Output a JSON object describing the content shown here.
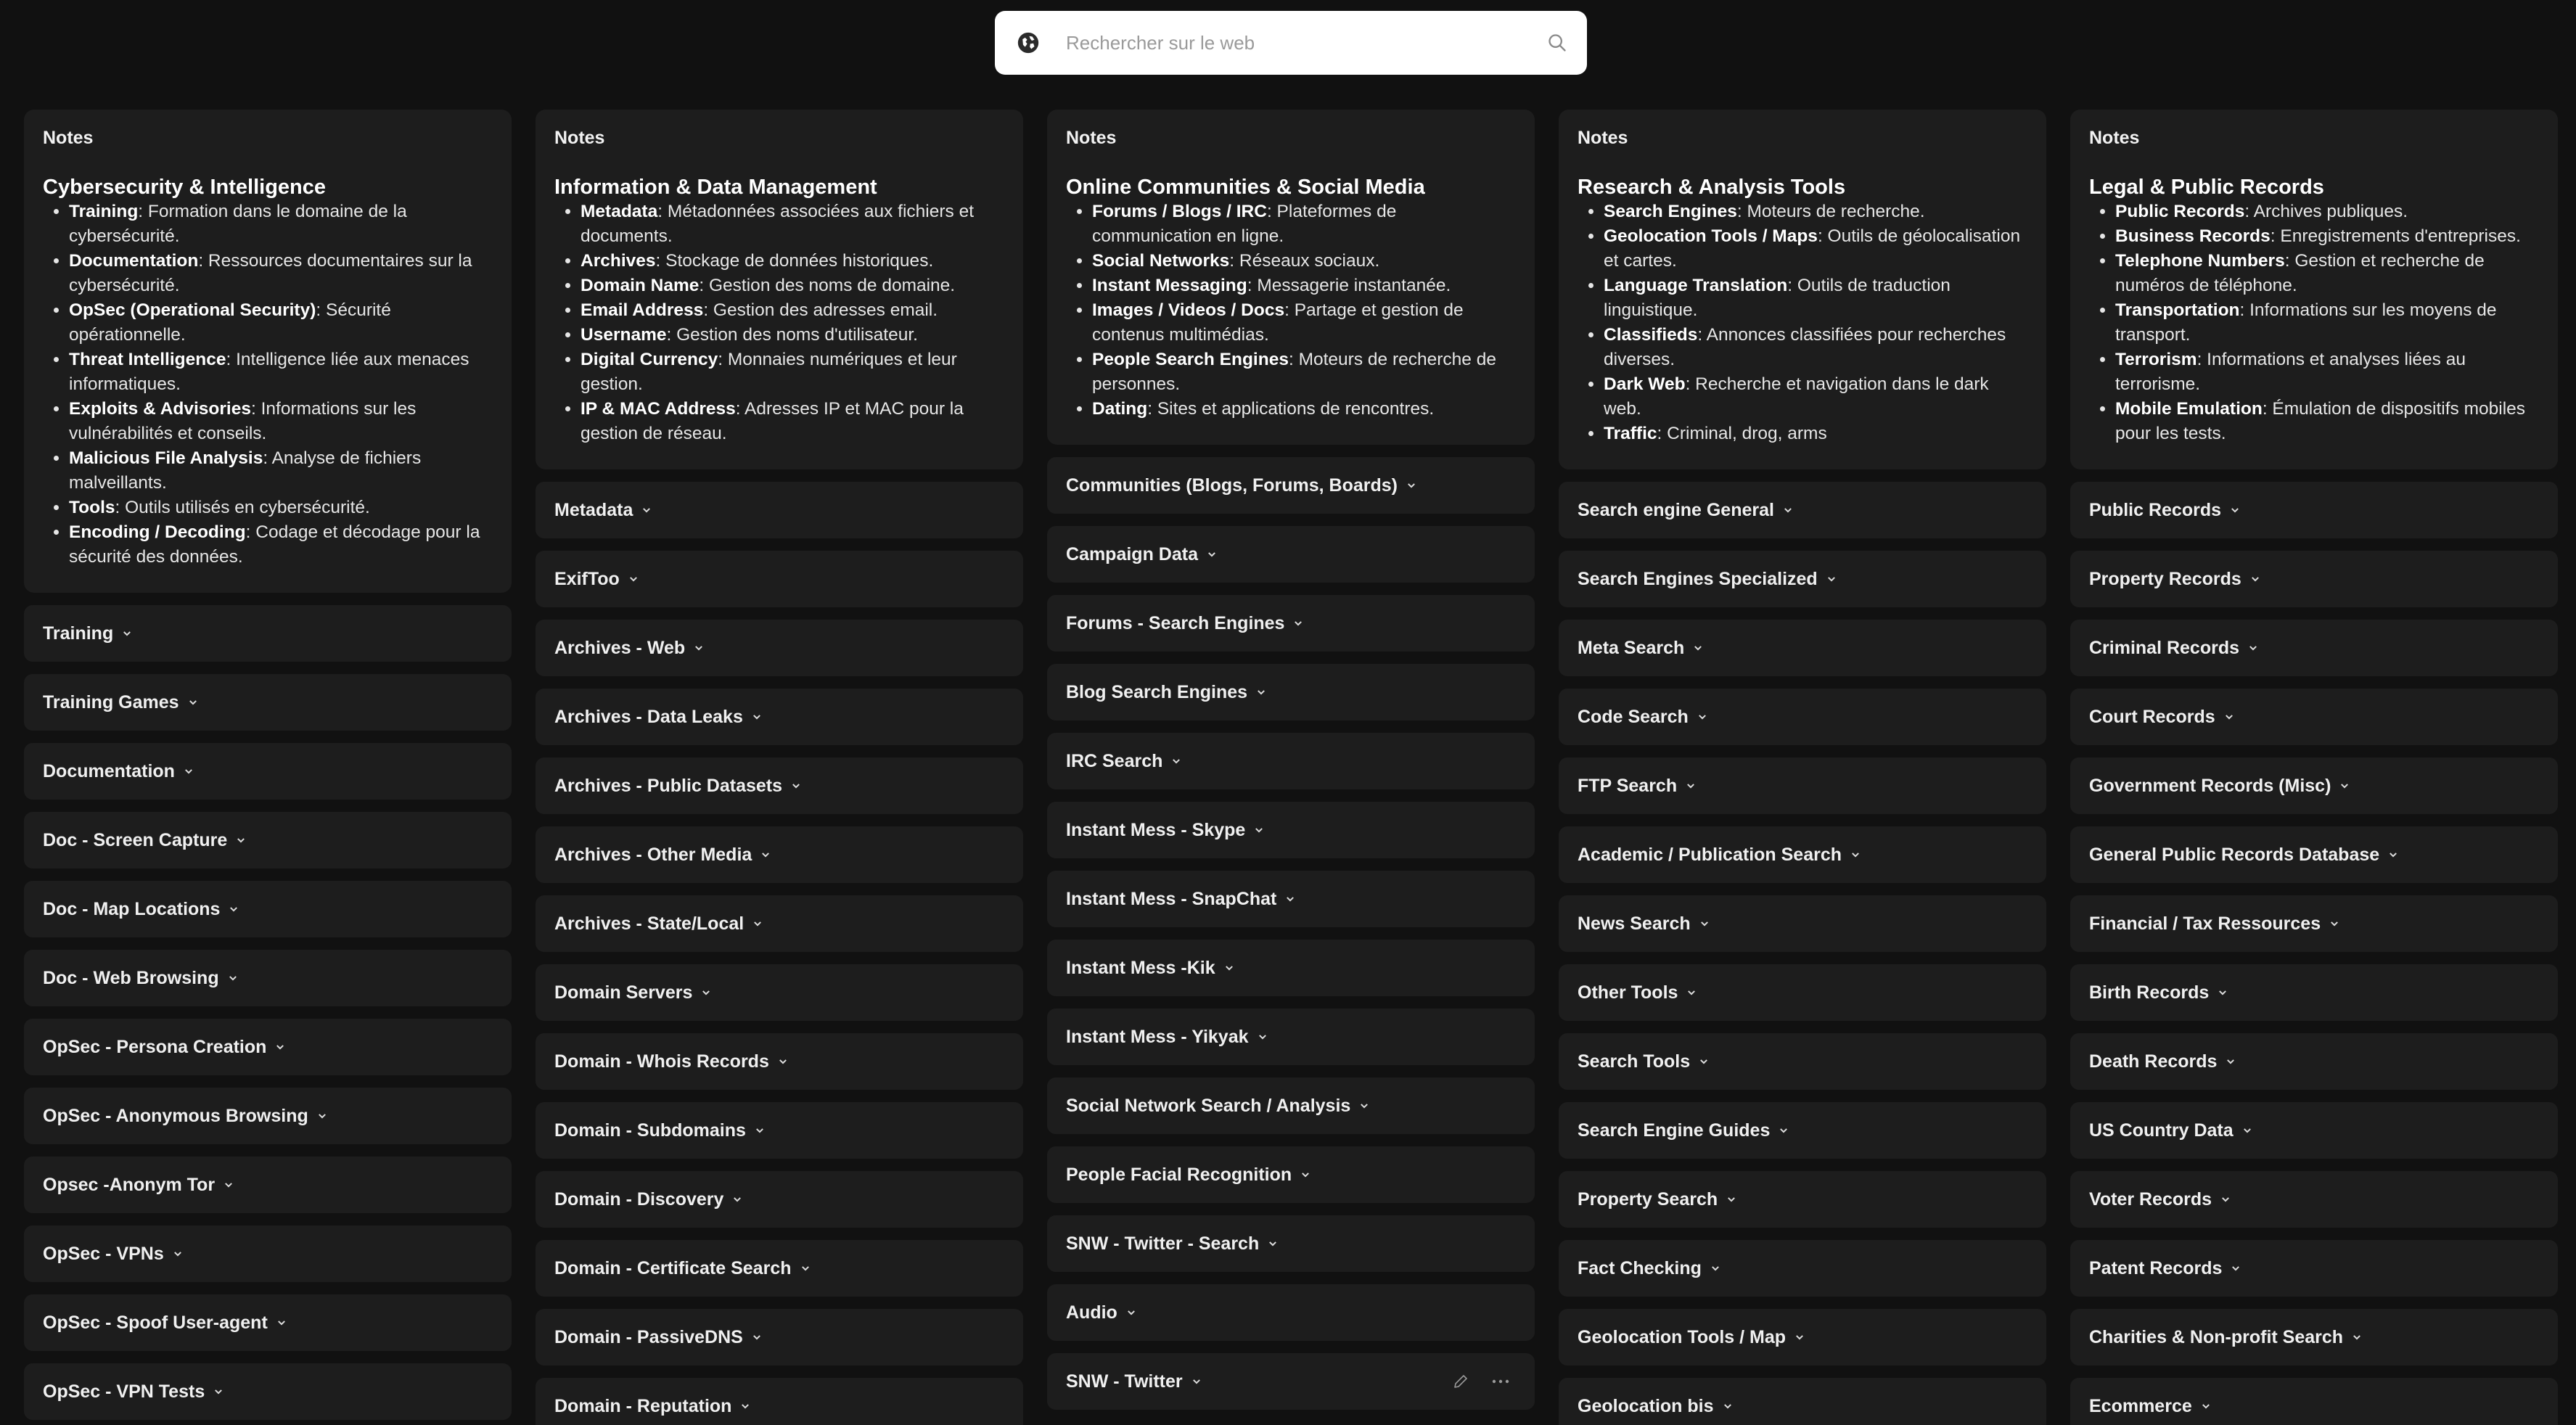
{
  "search": {
    "placeholder": "Rechercher sur le web"
  },
  "columns": [
    {
      "notes_label": "Notes",
      "title": "Cybersecurity & Intelligence",
      "bullets": [
        {
          "term": "Training",
          "desc": ": Formation dans le domaine de la cybersécurité."
        },
        {
          "term": "Documentation",
          "desc": ": Ressources documentaires sur la cybersécurité."
        },
        {
          "term": "OpSec (Operational Security)",
          "desc": ": Sécurité opérationnelle."
        },
        {
          "term": "Threat Intelligence",
          "desc": ": Intelligence liée aux menaces informatiques."
        },
        {
          "term": "Exploits & Advisories",
          "desc": ": Informations sur les vulnérabilités et conseils."
        },
        {
          "term": "Malicious File Analysis",
          "desc": ": Analyse de fichiers malveillants."
        },
        {
          "term": "Tools",
          "desc": ": Outils utilisés en cybersécurité."
        },
        {
          "term": "Encoding / Decoding",
          "desc": ": Codage et décodage pour la sécurité des données."
        }
      ],
      "items": [
        "Training",
        "Training Games",
        "Documentation",
        "Doc - Screen Capture",
        "Doc - Map Locations",
        "Doc - Web Browsing",
        "OpSec - Persona Creation",
        "OpSec - Anonymous Browsing",
        "Opsec -Anonym Tor",
        "OpSec - VPNs",
        "OpSec - Spoof User-agent",
        "OpSec - VPN Tests"
      ]
    },
    {
      "notes_label": "Notes",
      "title": "Information & Data Management",
      "bullets": [
        {
          "term": "Metadata",
          "desc": ": Métadonnées associées aux fichiers et documents."
        },
        {
          "term": "Archives",
          "desc": ": Stockage de données historiques."
        },
        {
          "term": "Domain Name",
          "desc": ": Gestion des noms de domaine."
        },
        {
          "term": "Email Address",
          "desc": ": Gestion des adresses email."
        },
        {
          "term": "Username",
          "desc": ": Gestion des noms d'utilisateur."
        },
        {
          "term": "Digital Currency",
          "desc": ": Monnaies numériques et leur gestion."
        },
        {
          "term": "IP & MAC Address",
          "desc": ": Adresses IP et MAC pour la gestion de réseau."
        }
      ],
      "items": [
        "Metadata",
        "ExifToo",
        "Archives - Web",
        "Archives - Data Leaks",
        "Archives - Public Datasets",
        "Archives - Other Media",
        "Archives - State/Local",
        "Domain Servers",
        "Domain - Whois Records",
        "Domain - Subdomains",
        "Domain - Discovery",
        "Domain - Certificate Search",
        "Domain - PassiveDNS",
        "Domain - Reputation"
      ]
    },
    {
      "notes_label": "Notes",
      "title": "Online Communities & Social Media",
      "bullets": [
        {
          "term": "Forums / Blogs / IRC",
          "desc": ": Plateformes de communication en ligne."
        },
        {
          "term": "Social Networks",
          "desc": ": Réseaux sociaux."
        },
        {
          "term": "Instant Messaging",
          "desc": ": Messagerie instantanée."
        },
        {
          "term": "Images / Videos / Docs",
          "desc": ": Partage et gestion de contenus multimédias."
        },
        {
          "term": "People Search Engines",
          "desc": ": Moteurs de recherche de personnes."
        },
        {
          "term": "Dating",
          "desc": ": Sites et applications de rencontres."
        }
      ],
      "items": [
        "Communities (Blogs, Forums, Boards)",
        "Campaign Data",
        "Forums - Search Engines",
        "Blog Search Engines",
        "IRC Search",
        "Instant Mess - Skype",
        "Instant Mess - SnapChat",
        "Instant Mess -Kik",
        "Instant Mess - Yikyak",
        "Social Network Search / Analysis",
        "People Facial Recognition",
        "SNW - Twitter - Search",
        "Audio",
        "SNW - Twitter"
      ]
    },
    {
      "notes_label": "Notes",
      "title": "Research & Analysis Tools",
      "bullets": [
        {
          "term": "Search Engines",
          "desc": ": Moteurs de recherche."
        },
        {
          "term": "Geolocation Tools / Maps",
          "desc": ": Outils de géolocalisation et cartes."
        },
        {
          "term": "Language Translation",
          "desc": ": Outils de traduction linguistique."
        },
        {
          "term": "Classifieds",
          "desc": ": Annonces classifiées pour recherches diverses."
        },
        {
          "term": "Dark Web",
          "desc": ": Recherche et navigation dans le dark web."
        },
        {
          "term": "Traffic",
          "desc": ": Criminal, drog, arms"
        }
      ],
      "items": [
        "Search engine General",
        "Search Engines Specialized",
        "Meta Search",
        "Code Search",
        "FTP Search",
        "Academic / Publication Search",
        "News Search",
        "Other Tools",
        "Search Tools",
        "Search Engine Guides",
        "Property Search",
        "Fact Checking",
        "Geolocation Tools / Map",
        "Geolocation bis"
      ]
    },
    {
      "notes_label": "Notes",
      "title": "Legal & Public Records",
      "bullets": [
        {
          "term": "Public Records",
          "desc": ": Archives publiques."
        },
        {
          "term": "Business Records",
          "desc": ": Enregistrements d'entreprises."
        },
        {
          "term": "Telephone Numbers",
          "desc": ": Gestion et recherche de numéros de téléphone."
        },
        {
          "term": "Transportation",
          "desc": ": Informations sur les moyens de transport."
        },
        {
          "term": "Terrorism",
          "desc": ": Informations et analyses liées au terrorisme."
        },
        {
          "term": "Mobile Emulation",
          "desc": ": Émulation de dispositifs mobiles pour les tests."
        }
      ],
      "items": [
        "Public Records",
        "Property Records",
        "Criminal Records",
        "Court Records",
        "Government Records (Misc)",
        "General Public Records Database",
        "Financial / Tax Ressources",
        "Birth Records",
        "Death Records",
        "US Country Data",
        "Voter Records",
        "Patent Records",
        "Charities & Non-profit Search",
        "Ecommerce"
      ]
    }
  ]
}
